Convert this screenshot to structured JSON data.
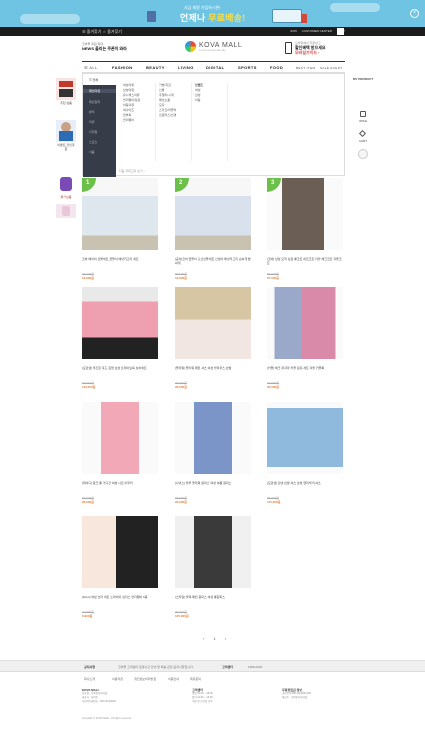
{
  "banner": {
    "small": "지금 회원 가입하시면!",
    "big_prefix": "언제나 ",
    "big_highlight": "무료배송!"
  },
  "topbar": {
    "left": "☰ 즐겨찾기    ☆ 즐겨찾기",
    "links": [
      "JOIN",
      "CUSTOMER CENTER",
      "CART"
    ]
  },
  "header": {
    "promo_small": "코바몰 회원 최대",
    "promo_big": "NEWS 올리는 쿠폰이 와라",
    "logo_text": "KOVA MALL",
    "logo_sub": "KOVA INTERNATIONAL MALL",
    "right_t1": "모바일에서 주문하고",
    "right_t2": "할인혜택 받으세요",
    "right_t3": "모바일가이드 ›"
  },
  "nav": {
    "all": "ALL",
    "items": [
      "FASHION",
      "BEAUTY",
      "LIVING",
      "DIGITAL",
      "SPORTS",
      "FOOD"
    ],
    "right": [
      "BEST ITEM",
      "SALE EVENT"
    ]
  },
  "dropdown": {
    "title": "전체",
    "left_items": [
      "패션의류",
      "패션잡화",
      "뷰티",
      "리빙",
      "디지털",
      "스포츠",
      "식품"
    ],
    "col1": [
      "여성의류",
      "남성의류",
      "유니섹스의류",
      "언더웨어/잠옷",
      "아동의류",
      "빅사이즈",
      "임부복",
      "언더웨어"
    ],
    "col2": [
      "가방/지갑",
      "신발",
      "주얼리/시계",
      "패션소품",
      "모자",
      "스카프/머플러",
      "선글라스/안경"
    ],
    "col3": [
      "브랜드",
      "여성",
      "남성",
      "아동"
    ],
    "footer": "다음 카테고리 보기 ›"
  },
  "left_side": {
    "banner1_caption": "추천 상품",
    "banner2_caption": "이벤트\n할인쿠폰",
    "banner3_caption": "특가상품"
  },
  "right_side": {
    "title": "MY PRODUCT",
    "wish": "WISH",
    "cart": "CART",
    "recent": "최근본상품"
  },
  "products": [
    {
      "rank": "1",
      "name": "코바 베이비 선물세트 곰돌이 배냇저고리 세트",
      "orig": "29,000원",
      "price": "16,900원"
    },
    {
      "rank": "2",
      "name": "[공식]코바 곰돌이 출산선물세트 신생아 배냇저고리 손싸개 발싸개",
      "orig": "29,000원",
      "price": "16,900원"
    },
    {
      "rank": "3",
      "name": "[코바] 남성 모직 싱글 롱코트 하프코트 더블 체크코트 겨울코트",
      "orig": "89,000원",
      "price": "57,000원"
    },
    {
      "rank": "",
      "name": "[모던맨] 루즈핏 후드 집업 남성 트레이닝복 상하세트",
      "orig": "39,000원",
      "price": "119,000원"
    },
    {
      "rank": "",
      "name": "[플라워] 플라워 패턴 셔츠 여성 블라우스 반팔",
      "orig": "29,000원",
      "price": "29,000원"
    },
    {
      "rank": "",
      "name": "[커플] 체크 파자마 커플 잠옷 세트 겨울 커플룩",
      "orig": "49,000원",
      "price": "35,000원"
    },
    {
      "rank": "",
      "name": "[레이디] 핑크 롱 가디건 여성 니트 아우터",
      "orig": "39,000원",
      "price": "26,900원"
    },
    {
      "rank": "",
      "name": "[나이스] 블루 플라워 원피스 여성 여름 원피스",
      "orig": "39,000원",
      "price": "29,900원"
    },
    {
      "rank": "",
      "name": "[모던맨] 린넨 반팔 셔츠 남성 헨리넥 티셔츠",
      "orig": "25,000원",
      "price": "115,000원"
    },
    {
      "rank": "",
      "name": "[Fiton] 여성 브라 세트 노와이어 심리스 언더웨어 6종",
      "orig": "19,900원",
      "price": "6,900원"
    },
    {
      "rank": "",
      "name": "[스타일] 블랙 패턴 원피스 여성 롱원피스",
      "orig": "39,000원",
      "price": "125,000원"
    }
  ],
  "pagination": "‹ 1 ›",
  "footer": {
    "notice_label": "공지사항",
    "notice_text": "코바몰 고객센터 운영시간 안내 및 배송 관련 공지사항입니다.",
    "cs_label": "고객센터",
    "cs_number": "1588-0000",
    "links": [
      "회사소개",
      "이용약관",
      "개인정보처리방침",
      "이용안내",
      "제휴문의"
    ],
    "col1_title": "KOVA MALL",
    "col1": [
      "상호명 : 코바인터내셔널",
      "대표자 : 홍길동",
      "사업자등록번호 : 000-00-00000"
    ],
    "col2_title": "고객센터",
    "col2": [
      "평일 10:00 ~ 18:00",
      "점심 12:00 ~ 13:00",
      "주말 및 공휴일 휴무"
    ],
    "col3_title": "무통장입금 정보",
    "col3": [
      "국민은행 000-00-0000-000",
      "예금주 : 코바인터내셔널"
    ],
    "copyright": "Copyright © KOVA MALL. All rights reserved."
  },
  "colors": {
    "banner_bg": "#6fc4e3",
    "badge_green": "#6cc04a",
    "price_orange": "#e8762b",
    "dark_sidebar": "#363c48"
  }
}
